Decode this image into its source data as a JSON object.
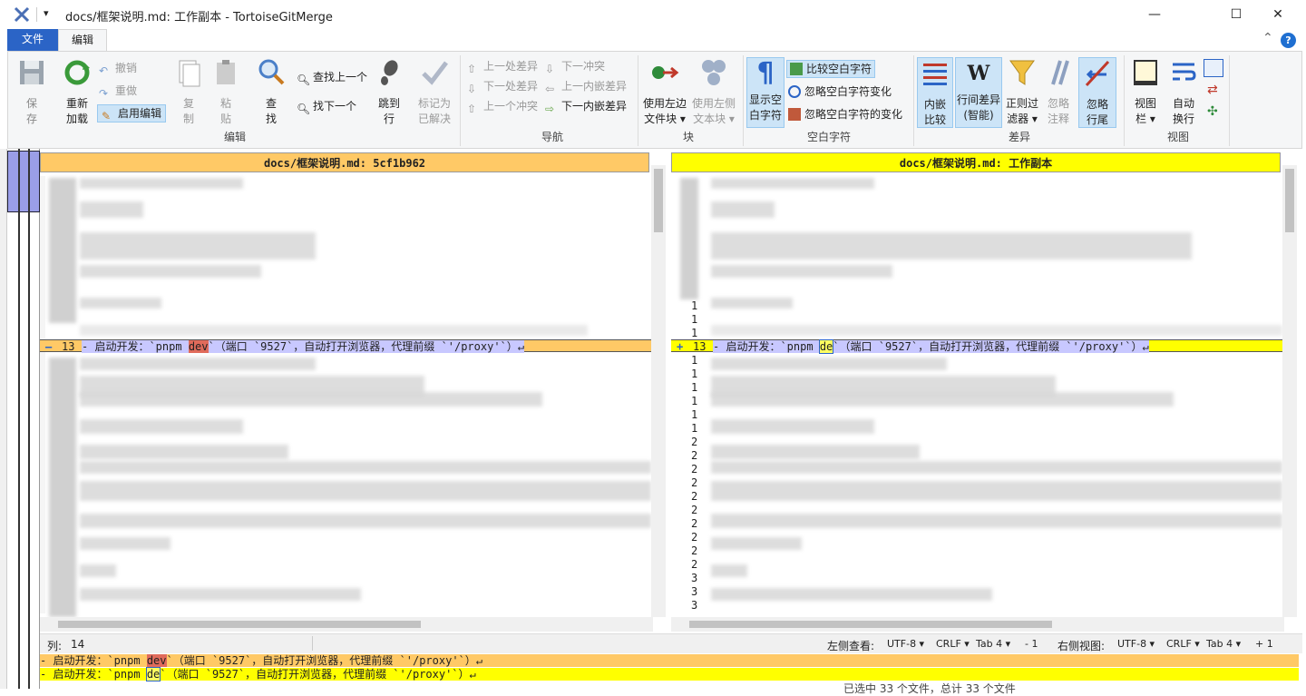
{
  "window": {
    "title": "docs/框架说明.md: 工作副本 - TortoiseGitMerge",
    "quick_access": "▾",
    "minimize": "—",
    "maximize": "☐",
    "close": "✕"
  },
  "ribbon_tabs": {
    "file": "文件",
    "edit": "编辑"
  },
  "ribbon_extra": {
    "collapse": "⌃",
    "help": "?"
  },
  "groups": {
    "edit": {
      "label": "编辑",
      "save": "保\n存",
      "reload": "重新\n加载",
      "undo": "撤销",
      "redo": "重做",
      "enable_edit": "启用编辑",
      "copy": "复\n制",
      "paste": "粘\n贴",
      "find": "查\n找",
      "find_prev": "查找上一个",
      "find_next": "找下一个",
      "goto_line": "跳到\n行",
      "mark_resolved": "标记为\n已解决"
    },
    "nav": {
      "label": "导航",
      "prev_diff": "上一处差异",
      "next_diff": "下一处差异",
      "prev_conflict": "上一个冲突",
      "next_conflict": "下一冲突",
      "prev_inline": "上一内嵌差异",
      "next_inline": "下一内嵌差异"
    },
    "block": {
      "label": "块",
      "use_left": "使用左边\n文件块 ▾",
      "use_right": "使用左侧\n文本块 ▾"
    },
    "whitespace": {
      "label": "空白字符",
      "show_ws": "显示空\n白字符",
      "compare_ws": "比较空白字符",
      "ignore_ws_changes": "忽略空白字符变化",
      "ignore_all_ws": "忽略空白字符的变化"
    },
    "diff": {
      "label": "差异",
      "inline": "内嵌\n比较",
      "linediff": "行间差异\n(智能)",
      "regex": "正则过\n滤器 ▾",
      "ignore_comments": "忽略\n注释",
      "ignore_eol": "忽略\n行尾"
    },
    "view": {
      "label": "视图",
      "view_bar": "视图\n栏 ▾",
      "wrap": "自动\n换行"
    }
  },
  "left_pane": {
    "header": "docs/框架说明.md: 5cf1b962",
    "header_color": "#ffc966",
    "marker": "—",
    "line_no": "13",
    "line_before": "- 启动开发：`pnpm ",
    "line_hl": "dev",
    "line_after": "`（端口 `9527`，自动打开浏览器，代理前缀 `'/proxy'`）↵"
  },
  "right_pane": {
    "header": "docs/框架说明.md: 工作副本",
    "header_color": "#ffff00",
    "marker": "+",
    "line_no": "13",
    "line_before": "- 启动开发：`pnpm ",
    "line_hl": "de",
    "line_after": "`（端口 `9527`，自动打开浏览器，代理前缀 `'/proxy'`）↵"
  },
  "status": {
    "column_label": "列:",
    "column_value": "14",
    "left_view": "左侧查看:",
    "left_enc": "UTF-8 ▾",
    "left_eol": "CRLF ▾",
    "left_tab": "Tab 4 ▾",
    "left_delta": "- 1",
    "right_view": "右侧视图:",
    "right_enc": "UTF-8 ▾",
    "right_eol": "CRLF ▾",
    "right_tab": "Tab 4 ▾",
    "right_delta": "+ 1"
  },
  "bottom": {
    "line1_before": "- 启动开发：`pnpm ",
    "line1_hl": "dev",
    "line1_after": "`（端口 `9527`，自动打开浏览器，代理前缀 `'/proxy'`）↵",
    "line2_before": "- 启动开发：`pnpm ",
    "line2_hl": "de",
    "line2_after": "`（端口 `9527`，自动打开浏览器，代理前缀 `'/proxy'`）↵",
    "footer": "已选中 33 个文件，总计 33 个文件"
  },
  "right_linenums": [
    "1",
    "1",
    "1",
    "13",
    "1",
    "1",
    "1",
    "1",
    "1",
    "1",
    "2",
    "2",
    "2",
    "2",
    "2",
    "2",
    "2",
    "2",
    "2",
    "2",
    "3",
    "3",
    "3"
  ]
}
